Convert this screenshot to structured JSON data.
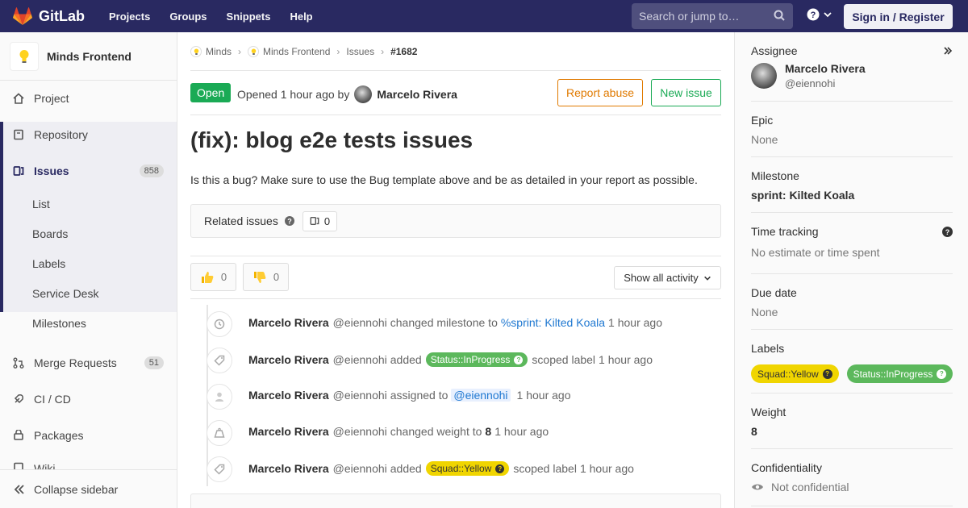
{
  "topbar": {
    "brand": "GitLab",
    "nav": [
      "Projects",
      "Groups",
      "Snippets",
      "Help"
    ],
    "search_placeholder": "Search or jump to…",
    "signin_label": "Sign in / Register"
  },
  "sidebar": {
    "project_name": "Minds Frontend",
    "items": [
      {
        "label": "Project"
      },
      {
        "label": "Repository"
      },
      {
        "label": "Issues",
        "count": "858"
      },
      {
        "label": "Merge Requests",
        "count": "51"
      },
      {
        "label": "CI / CD"
      },
      {
        "label": "Packages"
      },
      {
        "label": "Wiki"
      }
    ],
    "issue_subitems": [
      "List",
      "Boards",
      "Labels",
      "Service Desk",
      "Milestones"
    ],
    "collapse_label": "Collapse sidebar"
  },
  "breadcrumb": {
    "items": [
      "Minds",
      "Minds Frontend",
      "Issues"
    ],
    "current": "#1682"
  },
  "issue": {
    "status": "Open",
    "opened_text": "Opened 1 hour ago by",
    "author": "Marcelo Rivera",
    "report_abuse_label": "Report abuse",
    "new_issue_label": "New issue",
    "title": "(fix): blog e2e tests issues",
    "description": "Is this a bug? Make sure to use the Bug template above and be as detailed in your report as possible.",
    "related_label": "Related issues",
    "related_count": "0",
    "thumbs_up": "0",
    "thumbs_down": "0",
    "activity_filter": "Show all activity"
  },
  "notes": [
    {
      "icon": "clock-icon",
      "author": "Marcelo Rivera",
      "handle": "@eiennohi",
      "action": "changed milestone to",
      "link": "%sprint: Kilted Koala",
      "time": "1 hour ago"
    },
    {
      "icon": "tag-icon",
      "author": "Marcelo Rivera",
      "handle": "@eiennohi",
      "action": "added",
      "label": "Status::InProgress",
      "suffix": "scoped label",
      "time": "1 hour ago"
    },
    {
      "icon": "user-icon",
      "author": "Marcelo Rivera",
      "handle": "@eiennohi",
      "action": "assigned to",
      "mention": "@eiennohi",
      "time": "1 hour ago"
    },
    {
      "icon": "weight-icon",
      "author": "Marcelo Rivera",
      "handle": "@eiennohi",
      "action": "changed weight to",
      "value": "8",
      "time": "1 hour ago"
    },
    {
      "icon": "tag-icon",
      "author": "Marcelo Rivera",
      "handle": "@eiennohi",
      "action": "added",
      "label": "Squad::Yellow",
      "suffix": "scoped label",
      "time": "1 hour ago"
    }
  ],
  "right_sidebar": {
    "assignee_heading": "Assignee",
    "assignee_name": "Marcelo Rivera",
    "assignee_handle": "@eiennohi",
    "epic_heading": "Epic",
    "epic_value": "None",
    "milestone_heading": "Milestone",
    "milestone_value": "sprint: Kilted Koala",
    "time_heading": "Time tracking",
    "time_value": "No estimate or time spent",
    "due_heading": "Due date",
    "due_value": "None",
    "labels_heading": "Labels",
    "labels": [
      "Squad::Yellow",
      "Status::InProgress"
    ],
    "weight_heading": "Weight",
    "weight_value": "8",
    "conf_heading": "Confidentiality",
    "conf_value": "Not confidential"
  },
  "colors": {
    "topbar": "#292961",
    "open": "#1aaa55",
    "label_green": "#5cb85c",
    "label_yellow": "#f0d500",
    "abuse": "#e07a00"
  }
}
